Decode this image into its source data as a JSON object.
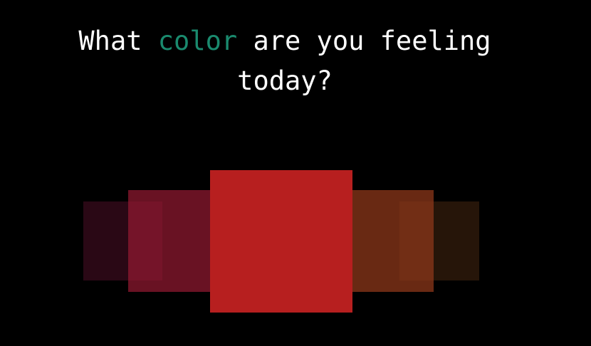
{
  "heading": {
    "pre": "What ",
    "accent_word": "color",
    "post_line1": " are you feeling",
    "line2": "today?",
    "accent_color": "#1a8a6e",
    "text_color": "#ffffff"
  },
  "background": "#000000",
  "swatches": [
    {
      "name": "swatch-far-left",
      "color": "rgba(120, 24, 60, 0.35)"
    },
    {
      "name": "swatch-near-left",
      "color": "rgba(150, 25, 50, 0.7)"
    },
    {
      "name": "swatch-center",
      "color": "#b71f1f"
    },
    {
      "name": "swatch-near-right",
      "color": "rgba(140, 55, 25, 0.75)"
    },
    {
      "name": "swatch-far-right",
      "color": "rgba(110, 60, 25, 0.35)"
    }
  ]
}
